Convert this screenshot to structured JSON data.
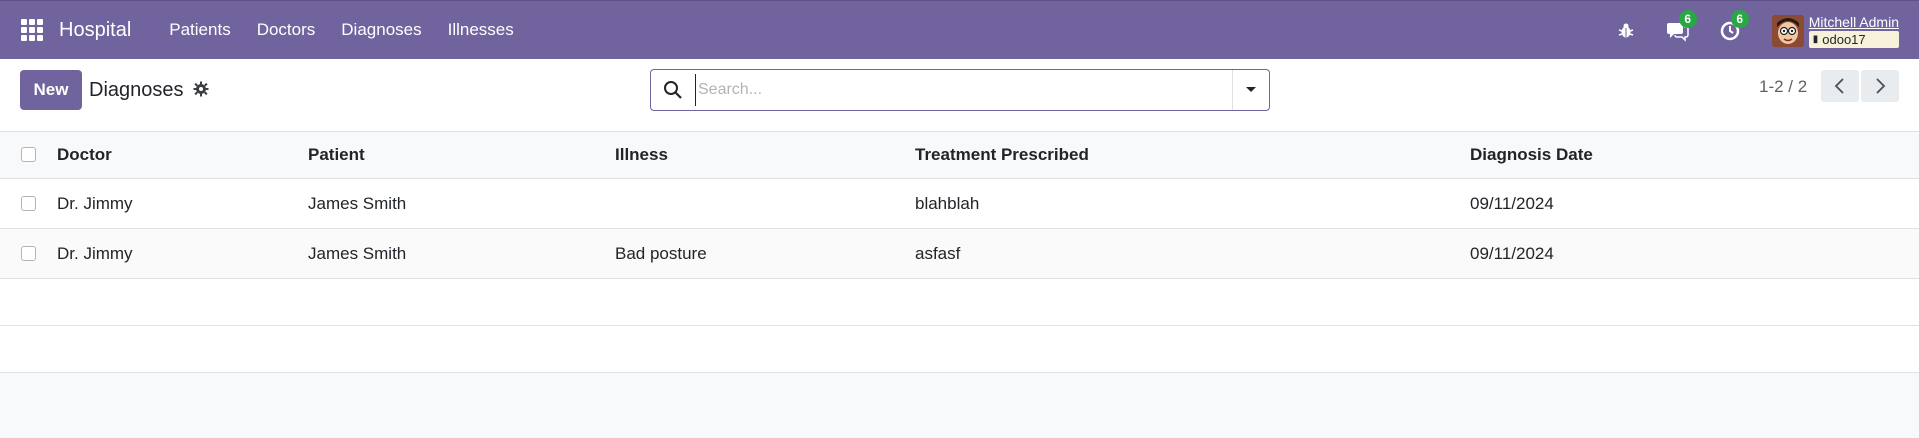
{
  "navbar": {
    "brand": "Hospital",
    "menu": [
      "Patients",
      "Doctors",
      "Diagnoses",
      "Illnesses"
    ],
    "messages_count": "6",
    "activities_count": "6",
    "user_name": "Mitchell Admin",
    "database": "odoo17",
    "accent_color": "#71639e",
    "badge_color": "#28a745"
  },
  "control_panel": {
    "new_label": "New",
    "title": "Diagnoses",
    "search_placeholder": "Search...",
    "pager": "1-2 / 2"
  },
  "table": {
    "columns": [
      "Doctor",
      "Patient",
      "Illness",
      "Treatment Prescribed",
      "Diagnosis Date"
    ],
    "rows": [
      {
        "doctor": "Dr. Jimmy",
        "patient": "James Smith",
        "illness": "",
        "treatment": "blahblah",
        "date": "09/11/2024"
      },
      {
        "doctor": "Dr. Jimmy",
        "patient": "James Smith",
        "illness": "Bad posture",
        "treatment": "asfasf",
        "date": "09/11/2024"
      }
    ]
  }
}
